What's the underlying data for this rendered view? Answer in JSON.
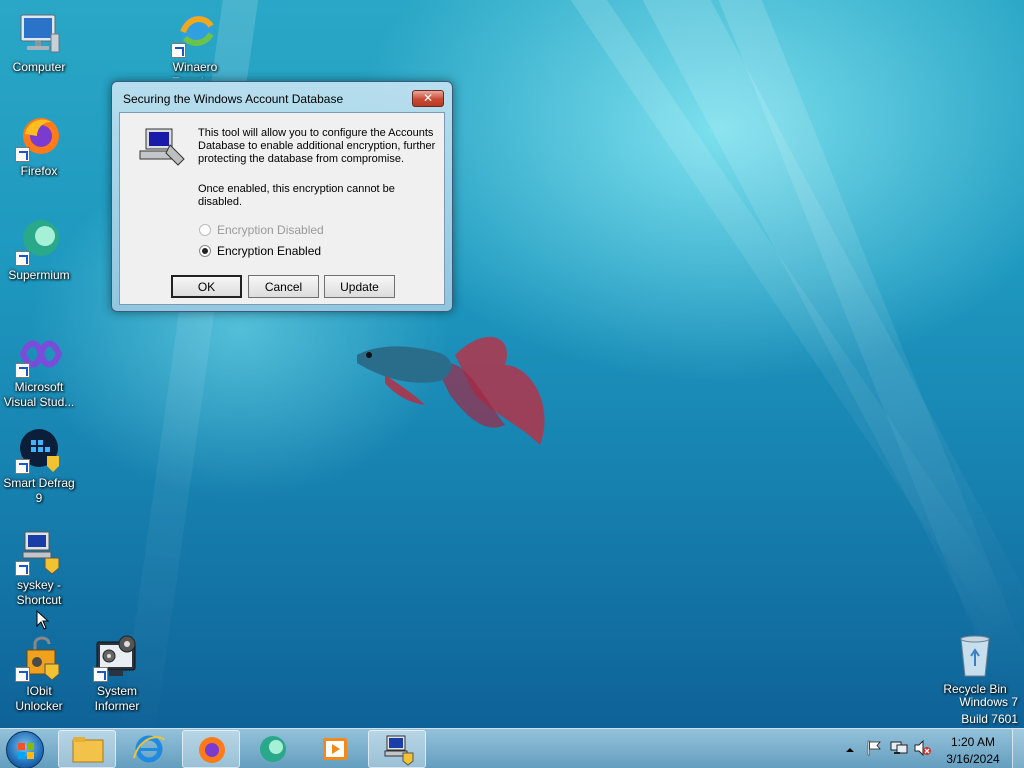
{
  "desktop": {
    "icons": [
      {
        "label": "Computer"
      },
      {
        "label": "Winaero Tweaker"
      },
      {
        "label": "Firefox"
      },
      {
        "label": "Supermium"
      },
      {
        "label": "Microsoft Visual Stud..."
      },
      {
        "label": "Smart Defrag 9"
      },
      {
        "label": "syskey - Shortcut"
      },
      {
        "label": "IObit Unlocker"
      },
      {
        "label": "System Informer"
      },
      {
        "label": "Recycle Bin"
      }
    ],
    "watermark": {
      "line1": "Windows 7",
      "line2": "Build 7601"
    }
  },
  "dialog": {
    "title": "Securing the Windows Account Database",
    "close_label": "✕",
    "description": "This tool will allow you to configure the Accounts Database to enable additional encryption, further protecting the database from compromise.",
    "warning": "Once enabled, this encryption cannot be disabled.",
    "options": [
      {
        "label": "Encryption Disabled",
        "checked": false,
        "enabled": false
      },
      {
        "label": "Encryption Enabled",
        "checked": true,
        "enabled": true
      }
    ],
    "buttons": {
      "ok": "OK",
      "cancel": "Cancel",
      "update": "Update"
    }
  },
  "taskbar": {
    "pinned": [
      "Windows Explorer",
      "Internet Explorer",
      "Firefox",
      "Supermium",
      "Media Player",
      "syskey"
    ],
    "active": "syskey",
    "clock": {
      "time": "1:20 AM",
      "date": "3/16/2024"
    }
  },
  "colors": {
    "close_button": "#c94a35",
    "accent": "#1f6fb8"
  }
}
